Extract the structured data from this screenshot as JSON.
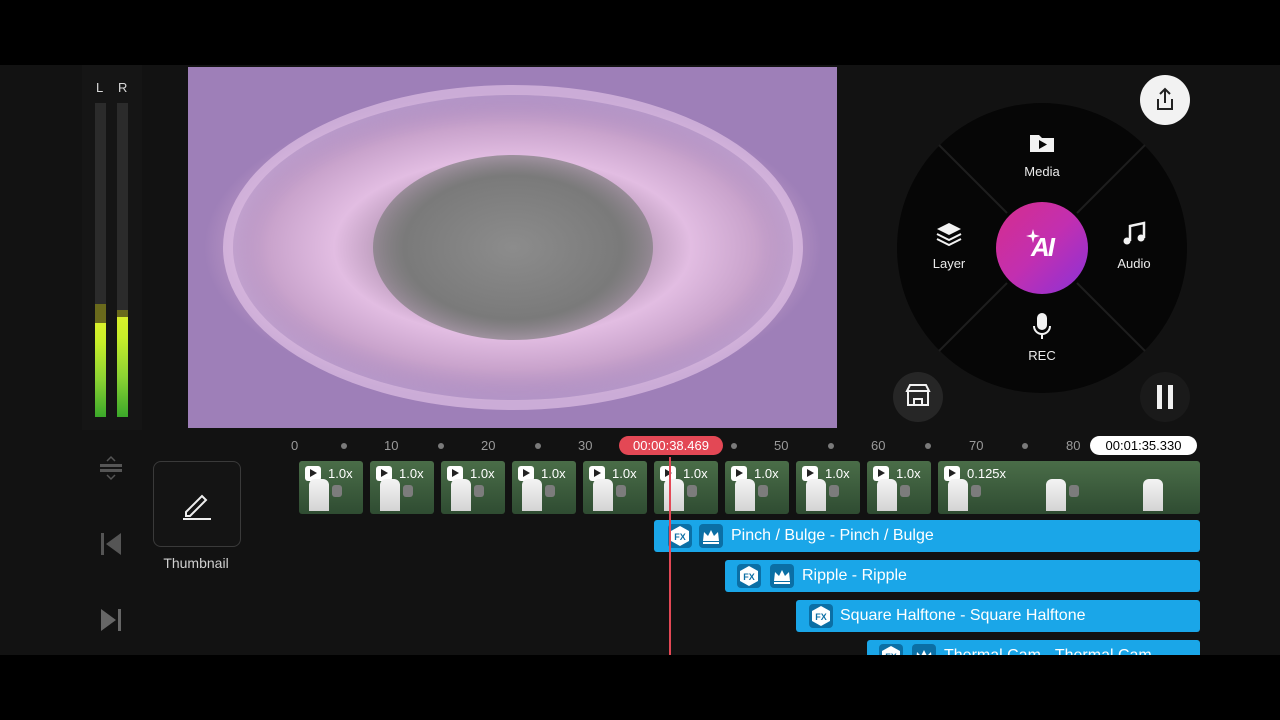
{
  "meters": {
    "left_label": "L",
    "right_label": "R",
    "left_level": 0.3,
    "right_level": 0.32,
    "left_peak": 0.36,
    "right_peak": 0.34
  },
  "radial_menu": {
    "media_label": "Media",
    "layer_label": "Layer",
    "audio_label": "Audio",
    "rec_label": "REC",
    "ai_label": "AI"
  },
  "ruler": {
    "ticks": [
      "0",
      "10",
      "20",
      "30",
      "50",
      "60",
      "70",
      "80"
    ],
    "playhead_time": "00:00:38.469",
    "total_time": "00:01:35.330"
  },
  "tools": {
    "thumbnail_label": "Thumbnail"
  },
  "clips": [
    {
      "speed": "1.0x"
    },
    {
      "speed": "1.0x"
    },
    {
      "speed": "1.0x"
    },
    {
      "speed": "1.0x"
    },
    {
      "speed": "1.0x"
    },
    {
      "speed": "1.0x"
    },
    {
      "speed": "1.0x"
    },
    {
      "speed": "1.0x"
    },
    {
      "speed": "1.0x"
    },
    {
      "speed": "0.125x"
    }
  ],
  "effects": [
    {
      "label": "Pinch / Bulge - Pinch / Bulge",
      "premium": true
    },
    {
      "label": "Ripple - Ripple",
      "premium": true
    },
    {
      "label": "Square Halftone - Square Halftone",
      "premium": false
    },
    {
      "label": "Thermal Cam - Thermal Cam",
      "premium": true
    }
  ],
  "colors": {
    "accent_playhead": "#e34855",
    "fx_bar": "#1aa6e8",
    "ai_gradient_start": "#d62e8c",
    "ai_gradient_end": "#8a32d8"
  }
}
